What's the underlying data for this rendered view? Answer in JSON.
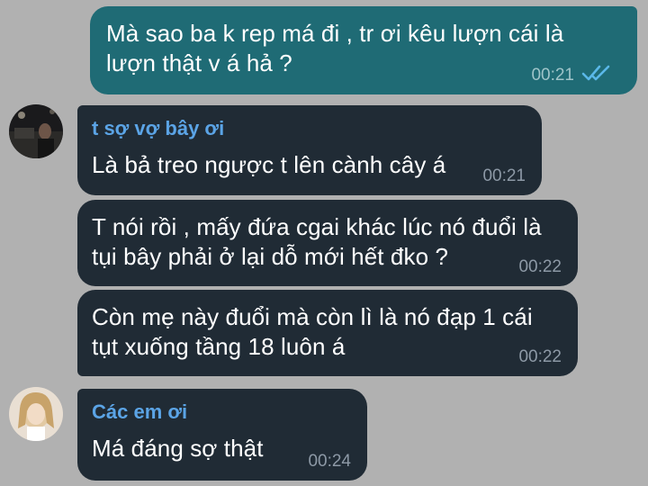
{
  "messages": [
    {
      "direction": "outgoing",
      "text": "Mà sao ba k rep má đi , tr ơi kêu lượn cái là\nlượn thật v á hả ?",
      "time": "00:21",
      "status_icon": "double-check-icon"
    },
    {
      "direction": "incoming",
      "sender": "t sợ vợ bây ơi",
      "text": "Là bả treo ngược t lên cành cây á",
      "time": "00:21"
    },
    {
      "direction": "incoming",
      "text": "T nói rồi , mấy đứa cgai khác lúc nó đuổi là\ntụi bây phải ở lại dỗ mới hết đko ?",
      "time": "00:22"
    },
    {
      "direction": "incoming",
      "text": "Còn mẹ này đuổi mà còn lì là nó đạp 1 cái\ntụt xuống tầng 18 luôn á",
      "time": "00:22"
    },
    {
      "direction": "incoming",
      "sender": "Các em ơi",
      "text": "Má đáng sợ thật",
      "time": "00:24"
    }
  ],
  "colors": {
    "background": "#b1b1b1",
    "outgoing_bubble": "#1f6b75",
    "incoming_bubble": "#202b35",
    "sender_name": "#5ba4e6",
    "read_ticks": "#5ab8e8"
  }
}
